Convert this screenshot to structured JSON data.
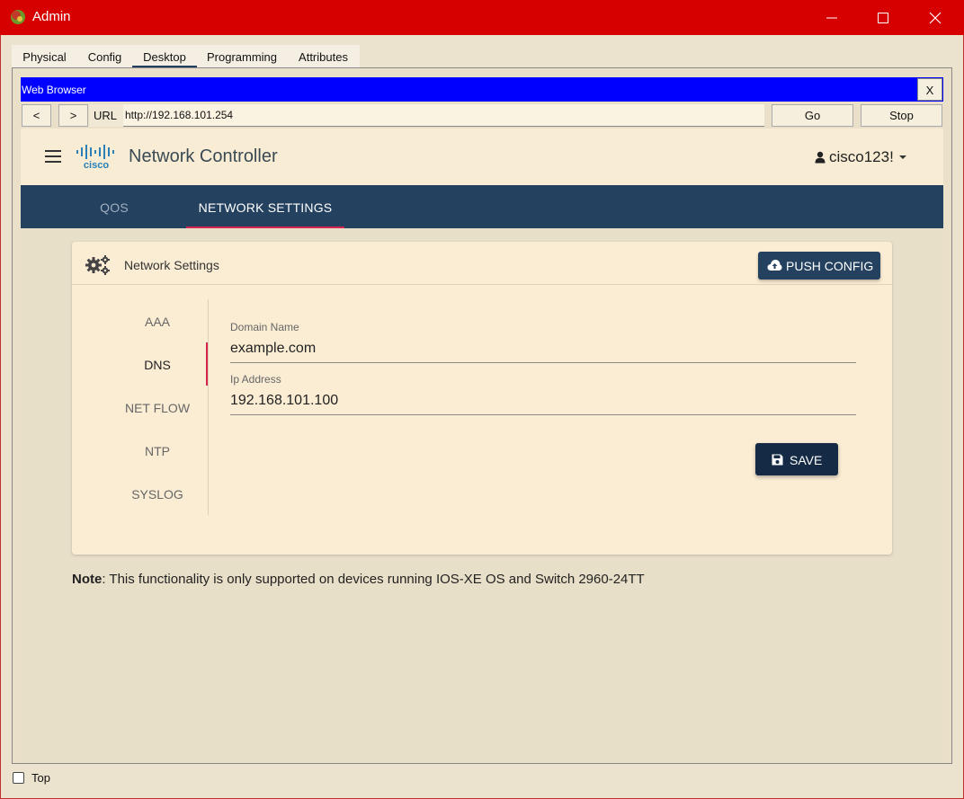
{
  "window": {
    "title": "Admin",
    "tabs": [
      {
        "label": "Physical"
      },
      {
        "label": "Config"
      },
      {
        "label": "Desktop"
      },
      {
        "label": "Programming"
      },
      {
        "label": "Attributes"
      }
    ],
    "active_tab": "Desktop",
    "top_checkbox_label": "Top",
    "top_checked": false,
    "colors": {
      "titlebar": "#d70000"
    }
  },
  "browser": {
    "title": "Web Browser",
    "close_label": "X",
    "back_label": "<",
    "forward_label": ">",
    "url_label": "URL",
    "url": "http://192.168.101.254",
    "go_label": "Go",
    "stop_label": "Stop",
    "colors": {
      "titlebar": "#0000ff"
    }
  },
  "app": {
    "brand": "cisco",
    "title": "Network Controller",
    "user": "cisco123!",
    "nav_tabs": [
      {
        "label": "QOS"
      },
      {
        "label": "NETWORK SETTINGS"
      }
    ],
    "active_nav": "NETWORK SETTINGS",
    "colors": {
      "navband": "#24415f",
      "accent": "#d6244f"
    }
  },
  "card": {
    "title": "Network Settings",
    "push_label": "PUSH CONFIG",
    "side_items": [
      {
        "label": "AAA"
      },
      {
        "label": "DNS"
      },
      {
        "label": "NET FLOW"
      },
      {
        "label": "NTP"
      },
      {
        "label": "SYSLOG"
      }
    ],
    "active_side": "DNS",
    "fields": [
      {
        "label": "Domain Name",
        "value": "example.com"
      },
      {
        "label": "Ip Address",
        "value": "192.168.101.100"
      }
    ],
    "save_label": "SAVE"
  },
  "note": {
    "bold": "Note",
    "text": ": This functionality is only supported on devices running IOS-XE OS and Switch 2960-24TT"
  }
}
